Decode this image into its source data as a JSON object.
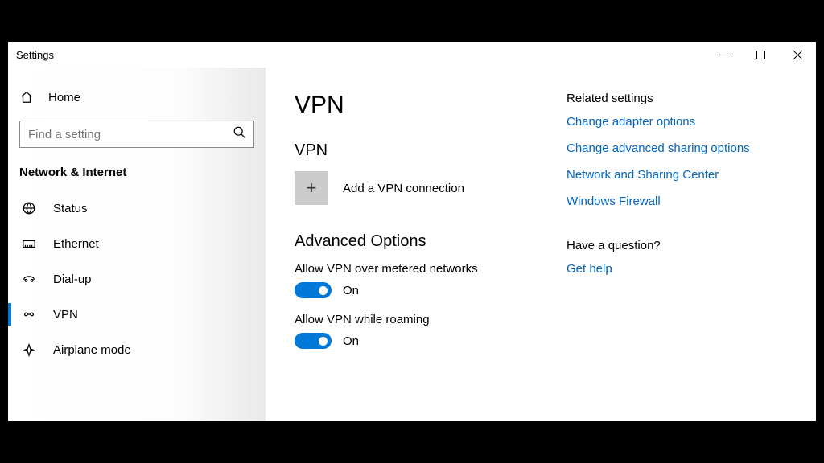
{
  "window": {
    "title": "Settings"
  },
  "sidebar": {
    "home": "Home",
    "search_placeholder": "Find a setting",
    "category": "Network & Internet",
    "items": [
      {
        "label": "Status"
      },
      {
        "label": "Ethernet"
      },
      {
        "label": "Dial-up"
      },
      {
        "label": "VPN"
      },
      {
        "label": "Airplane mode"
      }
    ]
  },
  "page": {
    "title": "VPN",
    "vpn_section": "VPN",
    "add_label": "Add a VPN connection",
    "advanced_section": "Advanced Options",
    "opt1_label": "Allow VPN over metered networks",
    "opt1_state": "On",
    "opt2_label": "Allow VPN while roaming",
    "opt2_state": "On"
  },
  "related": {
    "title": "Related settings",
    "links": [
      "Change adapter options",
      "Change advanced sharing options",
      "Network and Sharing Center",
      "Windows Firewall"
    ],
    "question_title": "Have a question?",
    "help_link": "Get help"
  }
}
